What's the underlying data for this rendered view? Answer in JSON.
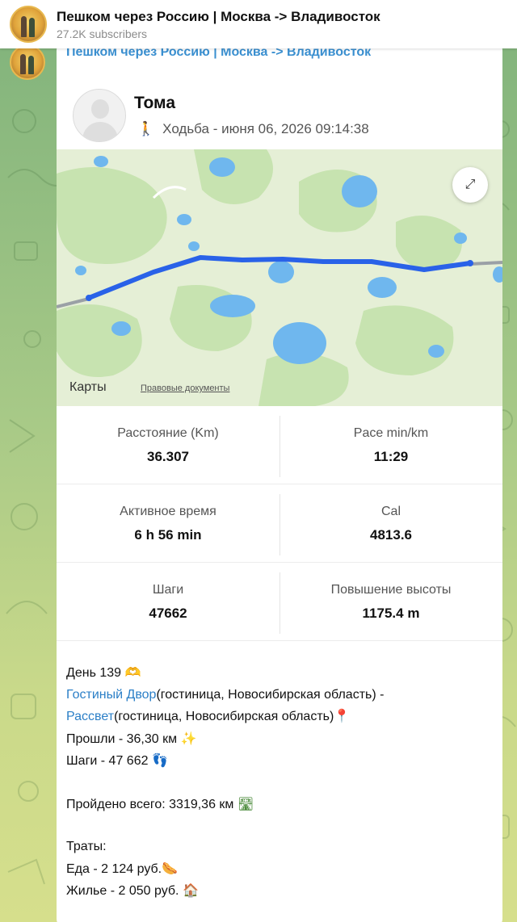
{
  "channel": {
    "title": "Пешком через Россию | Москва -> Владивосток",
    "subscribers": "27.2K subscribers"
  },
  "post": {
    "sender": "Пешком через Россию | Москва -> Владивосток",
    "user_name": "Тома",
    "activity": "Ходьба - июня 06, 2026 09:14:38",
    "map": {
      "logo": "Карты",
      "legal": "Правовые документы"
    },
    "stats": [
      {
        "label": "Расстояние (Km)",
        "value": "36.307"
      },
      {
        "label": "Pace min/km",
        "value": "11:29"
      },
      {
        "label": "Активное время",
        "value": "6 h 56 min"
      },
      {
        "label": "Cal",
        "value": "4813.6"
      },
      {
        "label": "Шаги",
        "value": "47662"
      },
      {
        "label": "Повышение высоты",
        "value": "1175.4 m"
      }
    ],
    "text": {
      "day": "День 139",
      "from_link": "Гостиный Двор",
      "from_rest": "(гостиница, Новосибирская область) -",
      "to_link": "Рассвет",
      "to_rest": "(гостиница, Новосибирская область)",
      "walked": "Прошли - 36,30 км",
      "steps": "Шаги - 47 662",
      "total": "Пройдено всего: 3319,36 км",
      "expenses_title": "Траты:",
      "food": "Еда - 2 124 руб.",
      "housing": "Жилье - 2 050 руб."
    }
  }
}
